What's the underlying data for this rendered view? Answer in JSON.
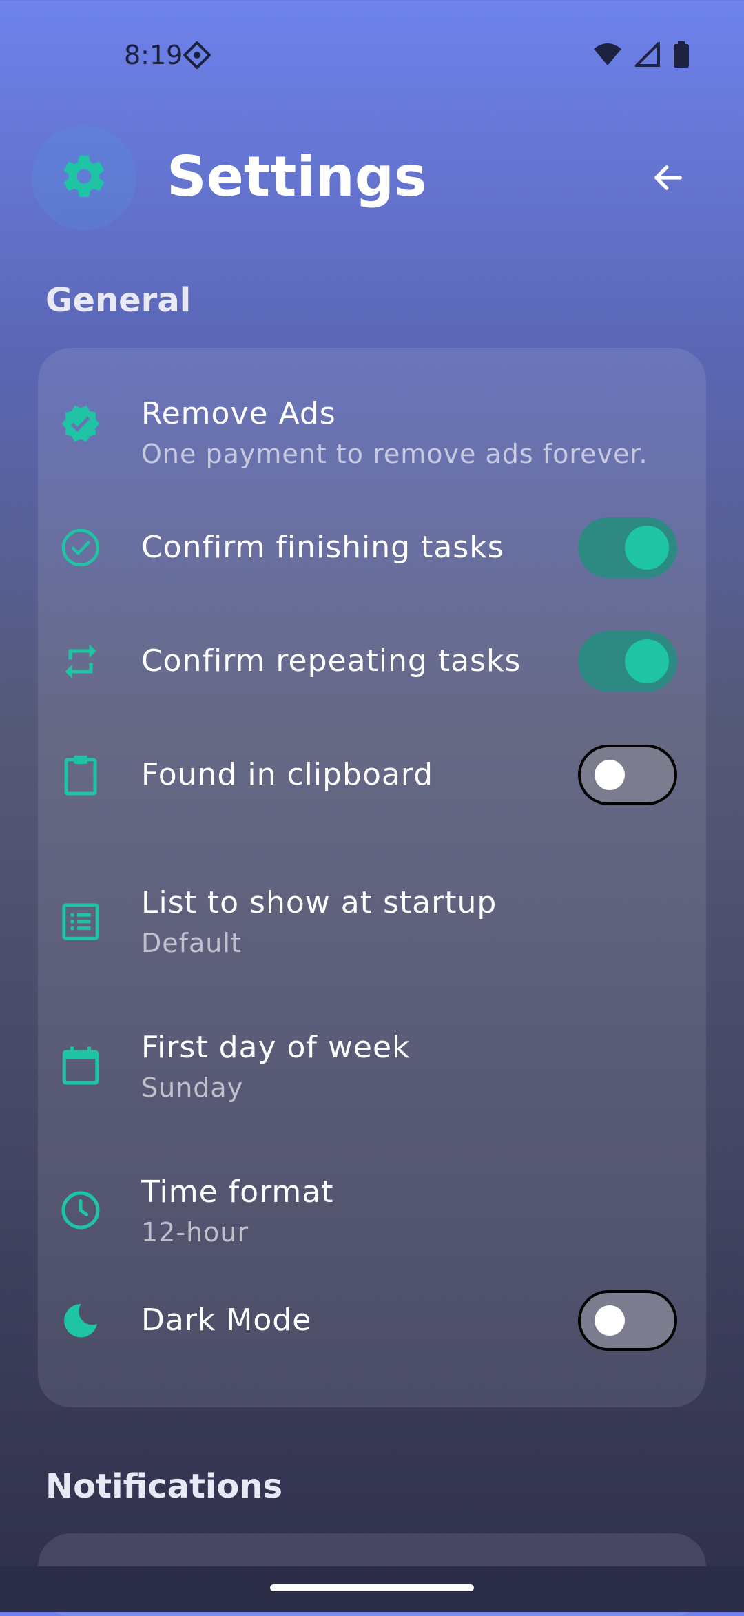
{
  "status_bar": {
    "time": "8:19"
  },
  "header": {
    "title": "Settings"
  },
  "sections": {
    "general": {
      "title": "General"
    },
    "notifications": {
      "title": "Notifications"
    }
  },
  "settings": {
    "remove_ads": {
      "title": "Remove Ads",
      "subtitle": "One payment to remove ads forever."
    },
    "confirm_finishing": {
      "title": "Confirm finishing tasks",
      "enabled": true
    },
    "confirm_repeating": {
      "title": "Confirm repeating tasks",
      "enabled": true
    },
    "clipboard": {
      "title": "Found in clipboard",
      "enabled": false
    },
    "startup_list": {
      "title": "List to show at startup",
      "value": "Default"
    },
    "first_day": {
      "title": "First day of week",
      "value": "Sunday"
    },
    "time_format": {
      "title": "Time format",
      "value": "12-hour"
    },
    "dark_mode": {
      "title": "Dark Mode",
      "enabled": false
    }
  },
  "icons": {
    "gear": "gear-icon",
    "back": "arrow-left-icon",
    "verified": "verified-badge-icon",
    "check": "check-circle-icon",
    "repeat": "repeat-icon",
    "clipboard": "clipboard-icon",
    "list": "list-icon",
    "calendar": "calendar-icon",
    "clock": "clock-icon",
    "moon": "moon-icon"
  },
  "colors": {
    "accent": "#1fc4a4",
    "toggle_on_track": "#2c8a82",
    "toggle_off_track": "#7b7c8d"
  }
}
